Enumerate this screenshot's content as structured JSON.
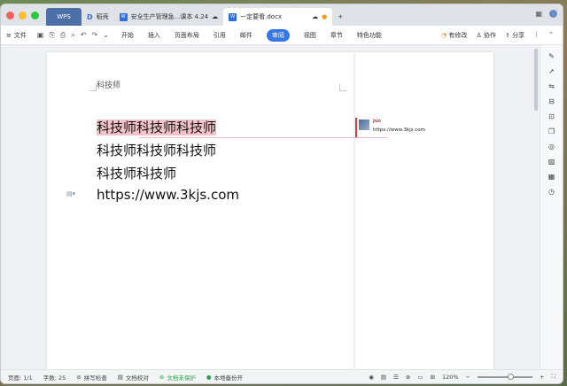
{
  "tabs": {
    "wps": "WPS",
    "daoke": "稻壳",
    "doc1": "安全生产管理急...课本 4.24",
    "doc2": "一定要看.docx"
  },
  "ribbon": {
    "file": "文件",
    "items": [
      "开始",
      "插入",
      "页面布局",
      "引用",
      "邮件",
      "审阅",
      "视图",
      "章节",
      "特色功能"
    ],
    "right": [
      "有修改",
      "协作",
      "分享"
    ]
  },
  "document": {
    "header": "科技师",
    "lines": [
      "科技师科技师科技师",
      "科技师科技师科技师",
      "科技师科技师",
      "https://www.3kjs.com"
    ]
  },
  "comment": {
    "author": "Jun",
    "text": "https://www.3kjs.com"
  },
  "status": {
    "page": "页面: 1/1",
    "words": "字数: 25",
    "spell": "拼写检查",
    "proof": "文档校对",
    "protect": "文档未保护",
    "backup": "本地备份开",
    "zoom": "120%"
  },
  "colors": {
    "accent": "#3577e6",
    "highlight": "#f2c3c8",
    "comment": "#d9363e"
  }
}
